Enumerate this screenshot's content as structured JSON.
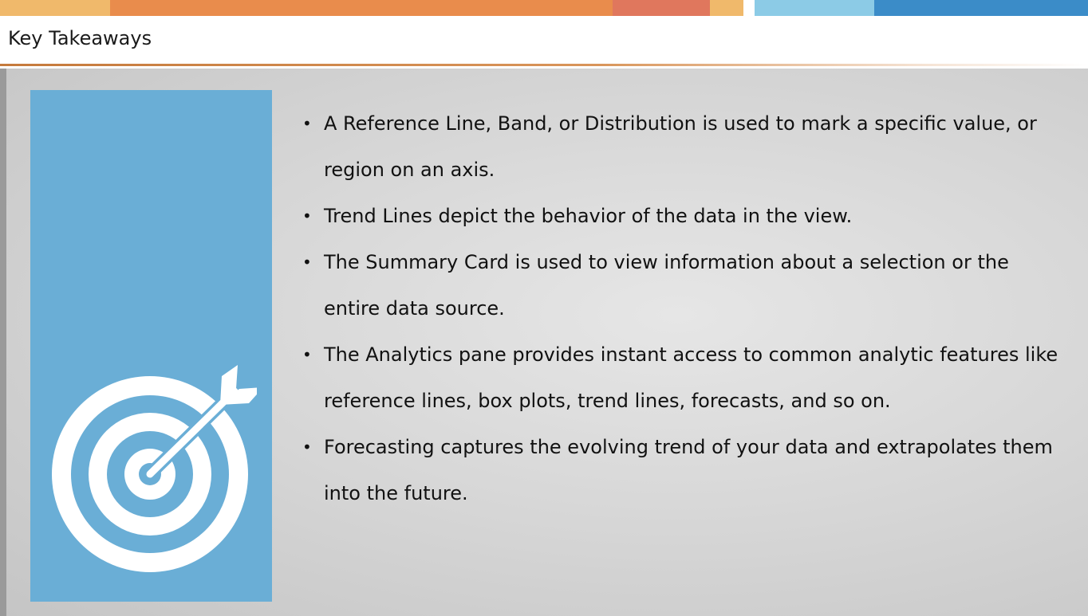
{
  "slide": {
    "title": "Key Takeaways",
    "colors": {
      "top_bar": [
        "#f0b96b",
        "#e98c4c",
        "#e0775d",
        "#f0b96b",
        "#ffffff",
        "#8ccbe6",
        "#3b8cc8"
      ],
      "panel": "#6aaed6",
      "accent_rule": "#c57a3c"
    },
    "icon": "target-with-arrow-icon",
    "bullets": [
      "A Reference Line, Band, or Distribution is used to mark a specific value, or region on an axis.",
      "Trend Lines depict the behavior of the data in the view.",
      "The Summary Card is used to view information about a selection or the entire data source.",
      "The Analytics pane provides instant access to common analytic features like reference lines, box plots, trend lines, forecasts, and so on.",
      "Forecasting captures the evolving trend of your data and extrapolates them into the future."
    ]
  }
}
